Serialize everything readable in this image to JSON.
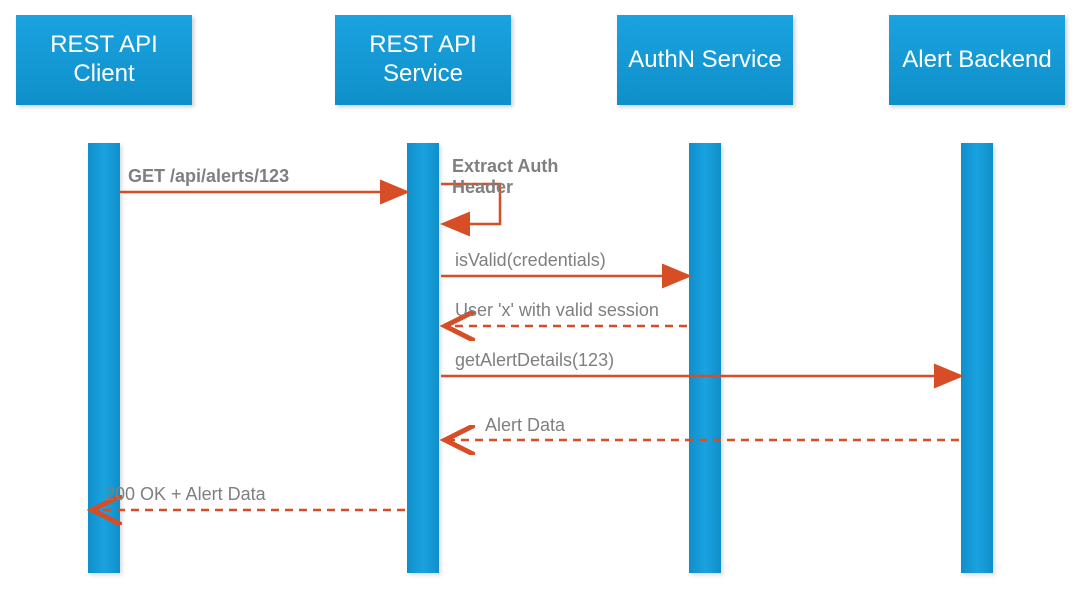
{
  "participants": {
    "client": {
      "label": "REST API\nClient"
    },
    "service": {
      "label": "REST API\nService"
    },
    "authn": {
      "label": "AuthN\nService"
    },
    "backend": {
      "label": "Alert\nBackend"
    }
  },
  "messages": {
    "m1": "GET /api/alerts/123",
    "m2": "Extract Auth\nHeader",
    "m3": "isValid(credentials)",
    "m4": "User 'x' with valid session",
    "m5": "getAlertDetails(123)",
    "m6": "Alert Data",
    "m7": "200 OK + Alert Data"
  },
  "colors": {
    "box": "#1aa3e0",
    "arrow": "#d64d26",
    "text": "#7f7f7f"
  }
}
